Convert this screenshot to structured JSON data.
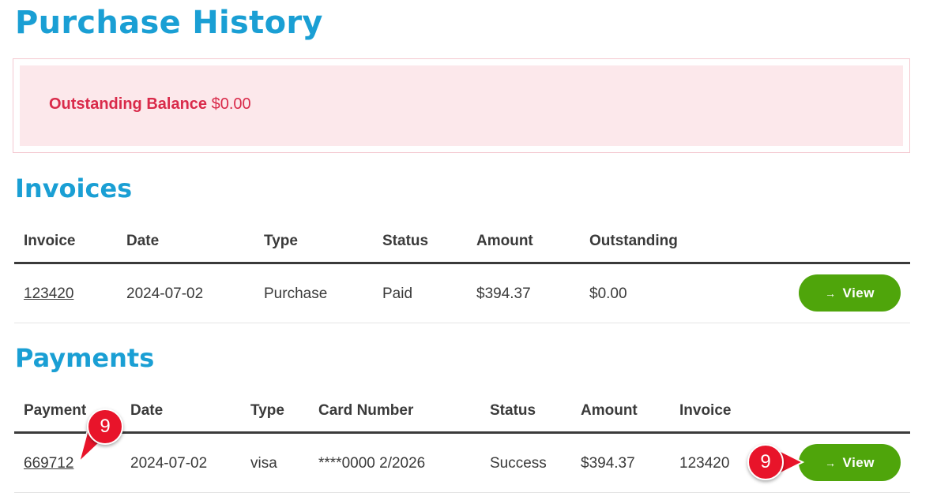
{
  "page": {
    "title": "Purchase History"
  },
  "balance": {
    "label": "Outstanding Balance",
    "value": "$0.00"
  },
  "invoices": {
    "title": "Invoices",
    "columns": [
      "Invoice",
      "Date",
      "Type",
      "Status",
      "Amount",
      "Outstanding"
    ],
    "rows": [
      {
        "invoice": "123420",
        "date": "2024-07-02",
        "type": "Purchase",
        "status": "Paid",
        "amount": "$394.37",
        "outstanding": "$0.00",
        "view_label": "View"
      }
    ]
  },
  "payments": {
    "title": "Payments",
    "columns": [
      "Payment",
      "Date",
      "Type",
      "Card Number",
      "Status",
      "Amount",
      "Invoice"
    ],
    "rows": [
      {
        "payment": "669712",
        "date": "2024-07-02",
        "type": "visa",
        "card_number": "****0000 2/2026",
        "status": "Success",
        "amount": "$394.37",
        "invoice": "123420",
        "view_label": "View"
      }
    ]
  },
  "callouts": {
    "first": "9",
    "second": "9"
  },
  "colors": {
    "accent": "#1a9fd4",
    "button": "#4fa50b",
    "alert_text": "#d92a4a",
    "alert_bg": "#fce8eb",
    "callout": "#e8142a"
  },
  "icons": {
    "view_arrow": "arrow-right-icon"
  }
}
